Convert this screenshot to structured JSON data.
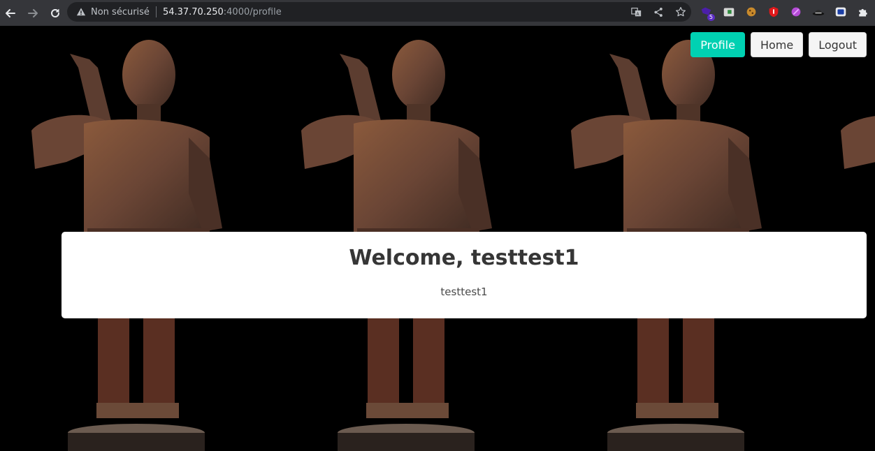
{
  "browser": {
    "security_label": "Non sécurisé",
    "url_host": "54.37.70.250",
    "url_path": ":4000/profile",
    "extension_badge": "5"
  },
  "nav": {
    "profile_label": "Profile",
    "home_label": "Home",
    "logout_label": "Logout"
  },
  "card": {
    "title": "Welcome, testtest1",
    "username": "testtest1"
  },
  "colors": {
    "primary": "#00d1b2",
    "toolbar": "#35363a",
    "omnibox": "#202124"
  }
}
